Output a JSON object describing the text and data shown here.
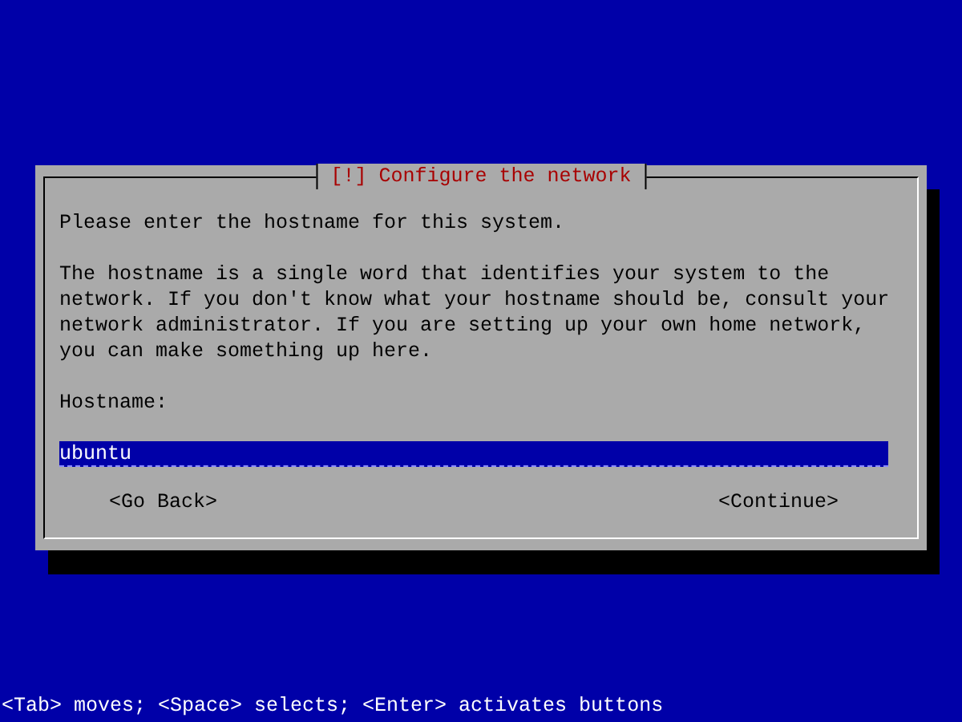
{
  "dialog": {
    "title": "[!] Configure the network",
    "paragraphs": [
      "Please enter the hostname for this system.",
      "The hostname is a single word that identifies your system to the network. If you don't know what your hostname should be, consult your network administrator. If you are setting up your own home network, you can make something up here."
    ],
    "field": {
      "label": "Hostname:",
      "value": "ubuntu"
    },
    "buttons": [
      "<Go Back>",
      "<Continue>"
    ]
  },
  "status_bar": "<Tab> moves; <Space> selects; <Enter> activates buttons"
}
